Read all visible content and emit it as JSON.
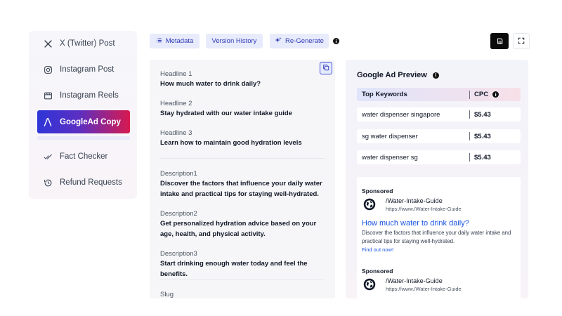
{
  "sidebar": {
    "items": [
      {
        "label": "X (Twitter) Post",
        "icon": "x-logo-icon"
      },
      {
        "label": "Instagram Post",
        "icon": "instagram-icon"
      },
      {
        "label": "Instagram Reels",
        "icon": "reels-icon"
      },
      {
        "label": "GoogleAd Copy",
        "icon": "google-ads-icon",
        "active": true
      },
      {
        "label": "Fact Checker",
        "icon": "check-icon"
      },
      {
        "label": "Refund Requests",
        "icon": "refund-icon"
      }
    ]
  },
  "toolbar": {
    "metadata_label": "Metadata",
    "version_history_label": "Version History",
    "regenerate_label": "Re-Generate",
    "info_glyph": "i"
  },
  "content": {
    "fields": [
      {
        "label": "Headline 1",
        "value": "How much water to drink daily?"
      },
      {
        "label": "Headline 2",
        "value": "Stay hydrated with our water intake guide"
      },
      {
        "label": "Headline 3",
        "value": "Learn how to maintain good hydration levels"
      },
      {
        "label": "Description1",
        "value": "Discover the factors that influence your daily water intake and practical tips for staying well-hydrated."
      },
      {
        "label": "Description2",
        "value": "Get personalized hydration advice based on your age, health, and physical activity."
      },
      {
        "label": "Description3",
        "value": "Start drinking enough water today and feel the benefits."
      },
      {
        "label": "Slug",
        "value": ""
      }
    ]
  },
  "preview": {
    "title": "Google Ad Preview",
    "keywords_header": "Top Keywords",
    "cpc_header": "CPC",
    "keywords": [
      {
        "keyword": "water dispenser singapore",
        "cpc": "$5.43"
      },
      {
        "keyword": "sg water dispenser",
        "cpc": "$5.43"
      },
      {
        "keyword": "water dispenser sg",
        "cpc": "$5.43"
      }
    ],
    "ads": [
      {
        "sponsored": "Sponsored",
        "name": "/Water-Intake-Guide",
        "url": "https://www./Water-Intake-Guide",
        "headline": "How much water to drink daily?",
        "description": "Discover the factors that influence your daily water intake and practical tips for staying well-hydrated.",
        "link": "Find out now!"
      },
      {
        "sponsored": "Sponsored",
        "name": "/Water-Intake-Guide",
        "url": "https://www./Water-Intake-Guide"
      }
    ]
  },
  "colors": {
    "accent": "#2f3ab8",
    "active_gradient_start": "#2f35d8",
    "active_gradient_end": "#d8194f",
    "link_blue": "#1a55e0"
  }
}
